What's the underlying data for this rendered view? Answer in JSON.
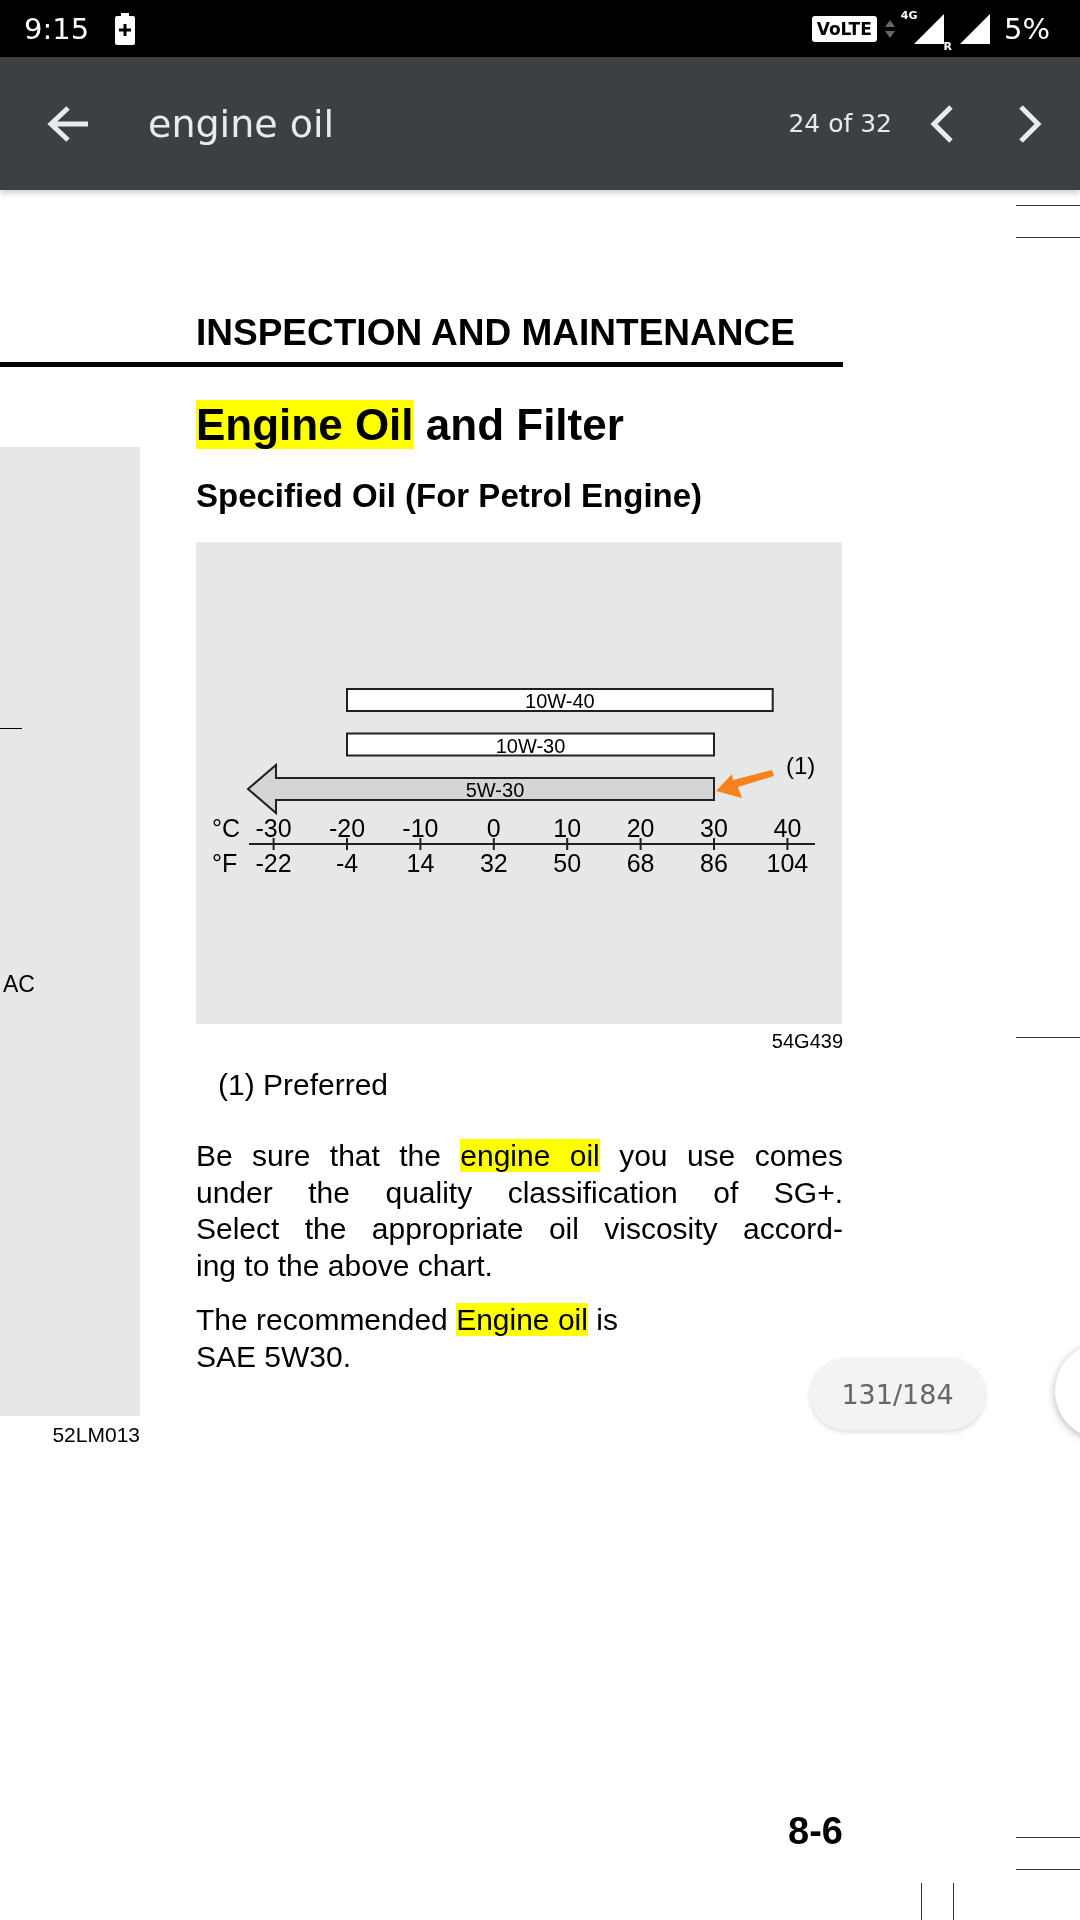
{
  "status_bar": {
    "time": "9:15",
    "volte": "VoLTE",
    "network": "4G",
    "roaming": "R",
    "battery": "5%"
  },
  "toolbar": {
    "query": "engine oil",
    "match_count": "24 of 32"
  },
  "left_page": {
    "text": "AC",
    "figure_code": "52LM013"
  },
  "page": {
    "section": "INSPECTION AND MAINTENANCE",
    "title": [
      {
        "text": "Engine Oil",
        "highlighted": true
      },
      {
        "text": " and Filter",
        "highlighted": false
      }
    ],
    "subtitle": "Specified Oil (For Petrol Engine)",
    "diagram": {
      "grades": [
        {
          "label": "10W-40",
          "kind": "bar"
        },
        {
          "label": "10W-30",
          "kind": "bar"
        },
        {
          "label": "5W-30",
          "kind": "arrow"
        }
      ],
      "celsius_unit": "°C",
      "celsius_ticks": [
        "-30",
        "-20",
        "-10",
        "0",
        "10",
        "20",
        "30",
        "40"
      ],
      "fahrenheit_unit": "°F",
      "fahrenheit_ticks": [
        "-22",
        "-4",
        "14",
        "32",
        "50",
        "68",
        "86",
        "104"
      ],
      "callout": "(1)"
    },
    "figure_code": "54G439",
    "note": "(1) Preferred",
    "paragraphs": [
      {
        "justify": true,
        "lines": [
          [
            {
              "text": "Be sure that the ",
              "highlighted": false
            },
            {
              "text": "engine oil",
              "highlighted": true
            },
            {
              "text": " you use comes",
              "highlighted": false
            }
          ],
          [
            {
              "text": "under the quality classification of SG+.",
              "highlighted": false
            }
          ],
          [
            {
              "text": "Select the appropriate oil viscosity accord-",
              "highlighted": false
            }
          ],
          [
            {
              "text": "ing to the above chart.",
              "highlighted": false
            }
          ]
        ]
      },
      {
        "justify": false,
        "lines": [
          [
            {
              "text": "The recommended ",
              "highlighted": false
            },
            {
              "text": "Engine oil",
              "highlighted": true
            },
            {
              "text": " is",
              "highlighted": false
            }
          ],
          [
            {
              "text": "SAE 5W30.",
              "highlighted": false
            }
          ]
        ]
      }
    ],
    "page_number": "8-6"
  },
  "page_indicator": "131/184"
}
